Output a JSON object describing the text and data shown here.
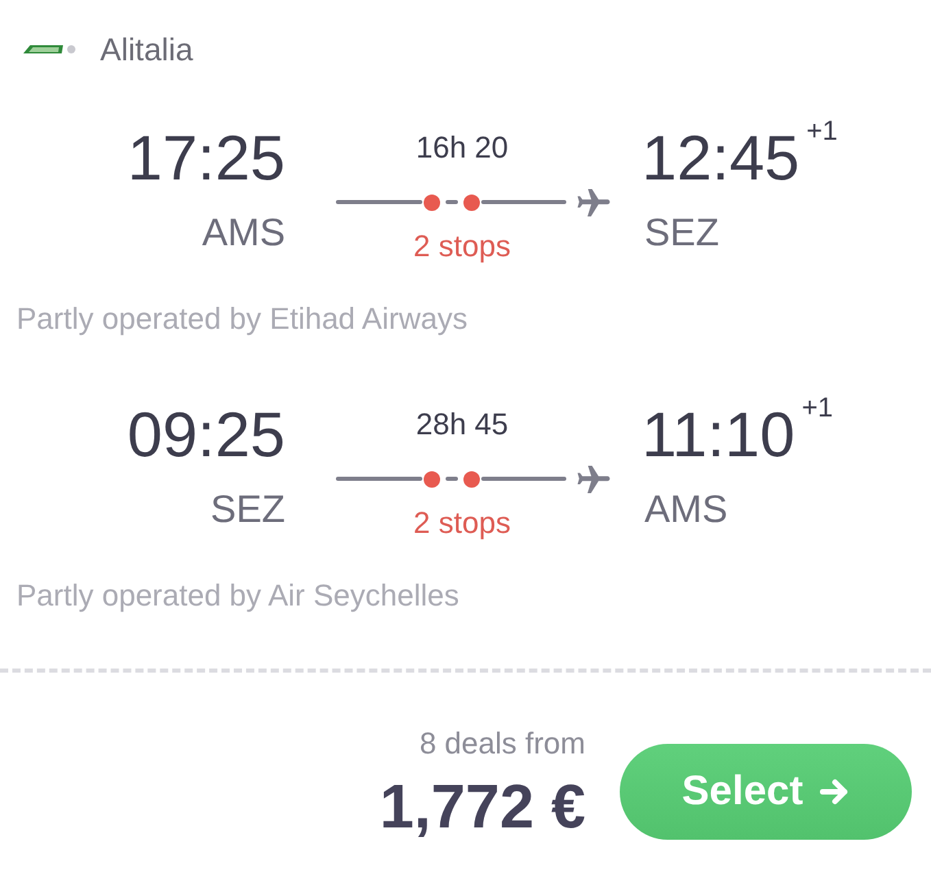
{
  "airline": {
    "name": "Alitalia"
  },
  "legs": [
    {
      "departure": {
        "time": "17:25",
        "airport": "AMS"
      },
      "duration": "16h 20",
      "route": {
        "kind": "two-stop"
      },
      "stops": "2 stops",
      "arrival": {
        "time": "12:45",
        "day_offset": "+1",
        "airport": "SEZ"
      },
      "operated_by": "Partly operated by Etihad Airways"
    },
    {
      "departure": {
        "time": "09:25",
        "airport": "SEZ"
      },
      "duration": "28h 45",
      "route": {
        "kind": "two-stop"
      },
      "stops": "2 stops",
      "arrival": {
        "time": "11:10",
        "day_offset": "+1",
        "airport": "AMS"
      },
      "operated_by": "Partly operated by Air Seychelles"
    }
  ],
  "offer": {
    "deals": "8 deals from",
    "price": "1,772 €",
    "button": "Select"
  }
}
